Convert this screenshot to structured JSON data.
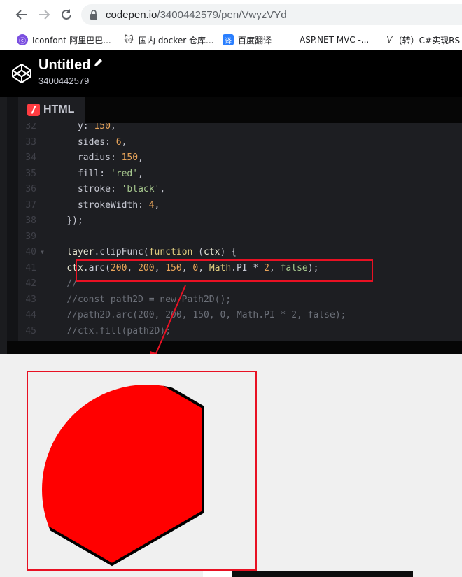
{
  "browser": {
    "url_host": "codepen.io",
    "url_path": "/3400442579/pen/VwyzVYd",
    "bookmarks": [
      {
        "label": "Iconfont-阿里巴巴...",
        "icon": "iconfont-icon"
      },
      {
        "label": "国内 docker 仓库...",
        "icon": "docker-icon"
      },
      {
        "label": "百度翻译",
        "icon": "translate-icon"
      },
      {
        "label": "ASP.NET MVC -...",
        "icon": "microsoft-icon"
      },
      {
        "label": "(转）C#实现RS",
        "icon": "cnblogs-icon"
      }
    ]
  },
  "pen": {
    "title": "Untitled",
    "user": "3400442579"
  },
  "editor": {
    "tab_label": "HTML",
    "lines": [
      {
        "num": "32",
        "tokens": [
          [
            "t-prop",
            "  y"
          ],
          [
            "t-punc",
            ": "
          ],
          [
            "t-num",
            "150"
          ],
          [
            "t-punc",
            ","
          ]
        ]
      },
      {
        "num": "33",
        "tokens": [
          [
            "t-prop",
            "  sides"
          ],
          [
            "t-punc",
            ": "
          ],
          [
            "t-num",
            "6"
          ],
          [
            "t-punc",
            ","
          ]
        ]
      },
      {
        "num": "34",
        "tokens": [
          [
            "t-prop",
            "  radius"
          ],
          [
            "t-punc",
            ": "
          ],
          [
            "t-num",
            "150"
          ],
          [
            "t-punc",
            ","
          ]
        ]
      },
      {
        "num": "35",
        "tokens": [
          [
            "t-prop",
            "  fill"
          ],
          [
            "t-punc",
            ": "
          ],
          [
            "t-str",
            "'red'"
          ],
          [
            "t-punc",
            ","
          ]
        ]
      },
      {
        "num": "36",
        "tokens": [
          [
            "t-prop",
            "  stroke"
          ],
          [
            "t-punc",
            ": "
          ],
          [
            "t-str",
            "'black'"
          ],
          [
            "t-punc",
            ","
          ]
        ]
      },
      {
        "num": "37",
        "tokens": [
          [
            "t-prop",
            "  strokeWidth"
          ],
          [
            "t-punc",
            ": "
          ],
          [
            "t-num",
            "4"
          ],
          [
            "t-punc",
            ","
          ]
        ]
      },
      {
        "num": "38",
        "tokens": [
          [
            "t-punc",
            "});"
          ]
        ]
      },
      {
        "num": "39",
        "tokens": []
      },
      {
        "num": "40",
        "fold": true,
        "tokens": [
          [
            "t-var",
            "layer"
          ],
          [
            "t-punc",
            "."
          ],
          [
            "t-fn",
            "clipFunc"
          ],
          [
            "t-punc",
            "("
          ],
          [
            "t-kw",
            "function"
          ],
          [
            "t-punc",
            " ("
          ],
          [
            "t-var",
            "ctx"
          ],
          [
            "t-punc",
            ") {"
          ]
        ]
      },
      {
        "num": "41",
        "tokens": [
          [
            "t-var",
            "ctx"
          ],
          [
            "t-punc",
            "."
          ],
          [
            "t-fn",
            "arc"
          ],
          [
            "t-punc",
            "("
          ],
          [
            "t-num",
            "200"
          ],
          [
            "t-punc",
            ", "
          ],
          [
            "t-num",
            "200"
          ],
          [
            "t-punc",
            ", "
          ],
          [
            "t-num",
            "150"
          ],
          [
            "t-punc",
            ", "
          ],
          [
            "t-num",
            "0"
          ],
          [
            "t-punc",
            ", "
          ],
          [
            "t-cls",
            "Math"
          ],
          [
            "t-punc",
            "."
          ],
          [
            "t-field",
            "PI"
          ],
          [
            "t-punc",
            " * "
          ],
          [
            "t-num",
            "2"
          ],
          [
            "t-punc",
            ", "
          ],
          [
            "t-bool",
            "false"
          ],
          [
            "t-punc",
            ");"
          ]
        ]
      },
      {
        "num": "42",
        "tokens": [
          [
            "t-cmt",
            "//"
          ]
        ]
      },
      {
        "num": "43",
        "tokens": [
          [
            "t-cmt",
            "//const path2D = new Path2D();"
          ]
        ]
      },
      {
        "num": "44",
        "tokens": [
          [
            "t-cmt",
            "//path2D.arc(200, 200, 150, 0, Math.PI * 2, false);"
          ]
        ]
      },
      {
        "num": "45",
        "tokens": [
          [
            "t-cmt",
            "//ctx.fill(path2D);"
          ]
        ]
      }
    ]
  },
  "colors": {
    "annotation": "#e81123",
    "shape_fill": "#ff0000",
    "shape_stroke": "#000000"
  }
}
